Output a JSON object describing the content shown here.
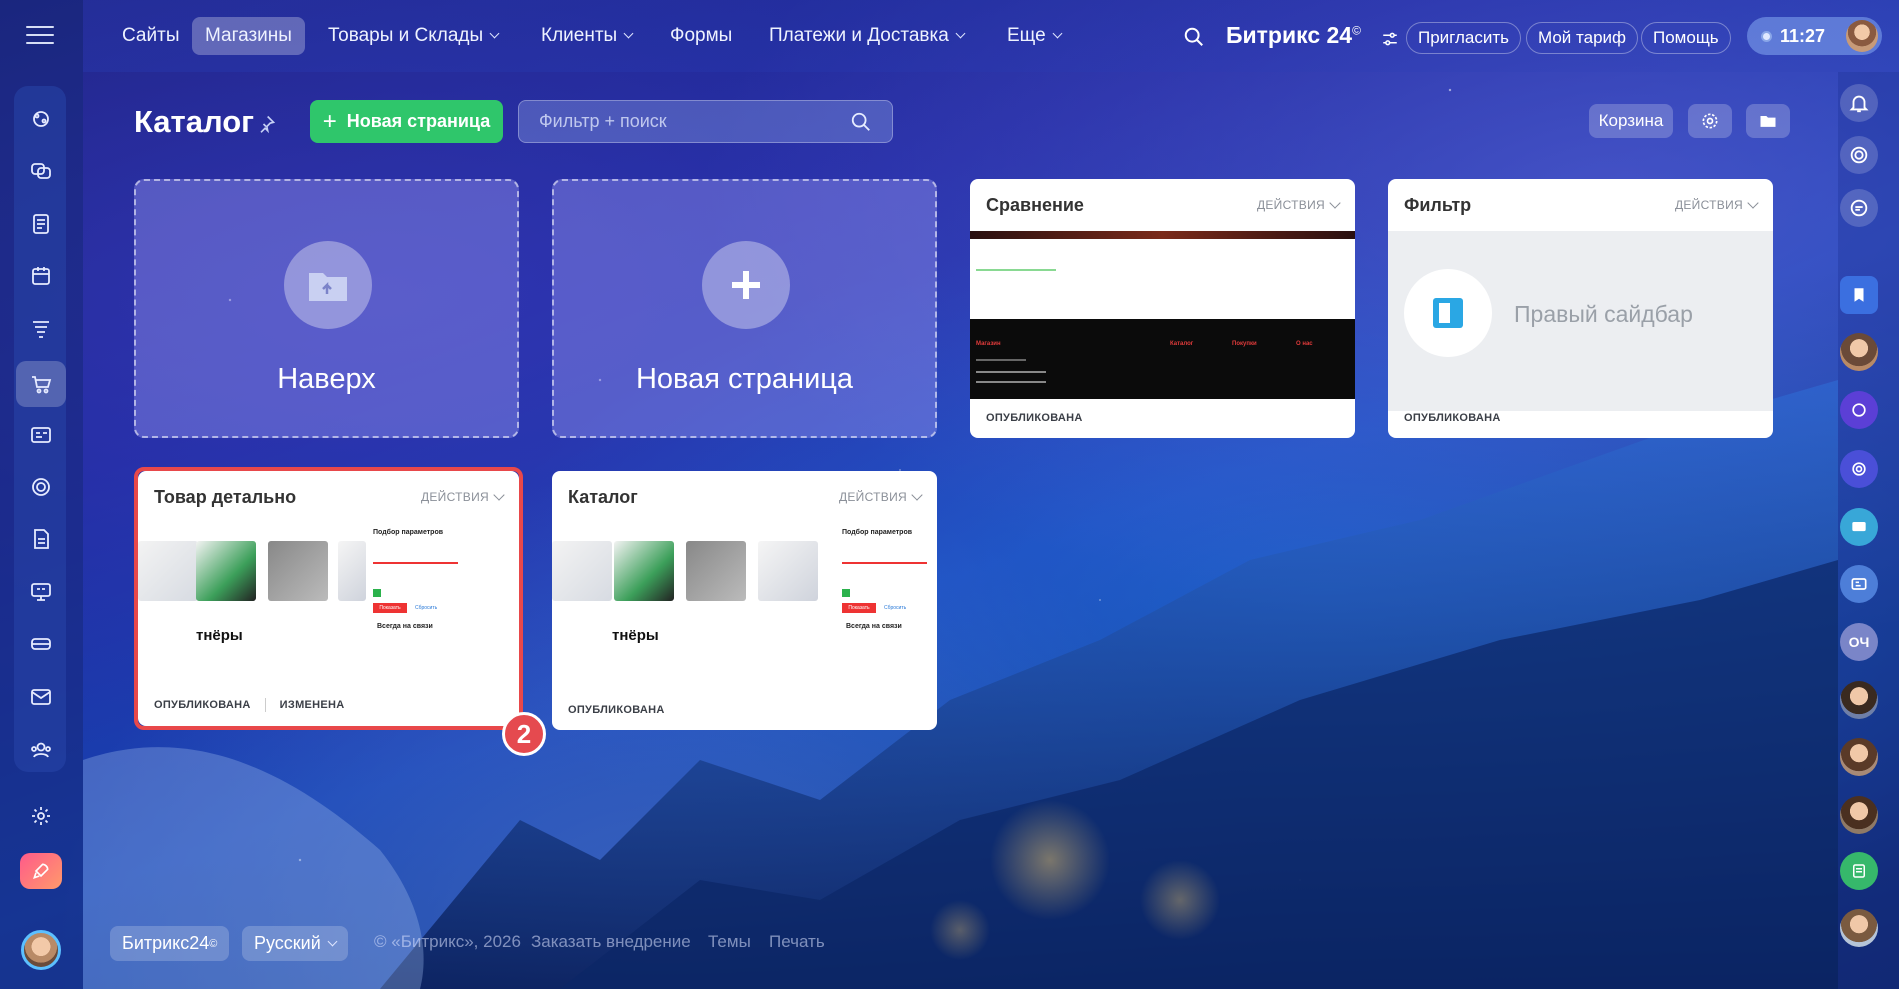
{
  "topnav": {
    "items": [
      {
        "label": "Сайты"
      },
      {
        "label": "Магазины",
        "active": true
      },
      {
        "label": "Товары и Склады",
        "dropdown": true
      },
      {
        "label": "Клиенты",
        "dropdown": true
      },
      {
        "label": "Формы"
      },
      {
        "label": "Платежи и Доставка",
        "dropdown": true
      },
      {
        "label": "Еще",
        "dropdown": true
      }
    ],
    "brand": "Битрикс 24",
    "brand_mark": "©",
    "invite_label": "Пригласить",
    "tariff_label": "Мой тариф",
    "help_label": "Помощь",
    "time": "11:27"
  },
  "page": {
    "title": "Каталог",
    "new_page_button": "Новая страница",
    "new_page_plus": "+",
    "search_placeholder": "Фильтр + поиск",
    "cart_button": "Корзина"
  },
  "cards": {
    "up": {
      "label": "Наверх"
    },
    "new_page": {
      "label": "Новая страница"
    },
    "comparison": {
      "title": "Сравнение",
      "actions": "ДЕЙСТВИЯ",
      "status": "ОПУБЛИКОВАНА",
      "preview": {
        "col1": "Магазин",
        "col2": "Каталог",
        "col3": "Покупки",
        "col4": "О нас"
      }
    },
    "filter": {
      "title": "Фильтр",
      "actions": "ДЕЙСТВИЯ",
      "status": "ОПУБЛИКОВАНА",
      "preview_text": "Правый сайдбар"
    },
    "product_detail": {
      "title": "Товар детально",
      "actions": "ДЕЙСТВИЯ",
      "status": "ОПУБЛИКОВАНА",
      "status2": "ИЗМЕНЕНА",
      "preview": {
        "filter_head": "Подбор параметров",
        "apply": "Показать",
        "reset": "Сбросить",
        "contact": "Всегда на связи",
        "brand": "тнёры"
      }
    },
    "catalog": {
      "title": "Каталог",
      "actions": "ДЕЙСТВИЯ",
      "status": "ОПУБЛИКОВАНА",
      "preview": {
        "filter_head": "Подбор параметров",
        "apply": "Показать",
        "reset": "Сбросить",
        "contact": "Всегда на связи",
        "brand": "тнёры"
      }
    }
  },
  "step_badge": "2",
  "right_rail": {
    "initials": "ОЧ"
  },
  "footer": {
    "brand": "Битрикс24",
    "brand_mark": "©",
    "language": "Русский",
    "copyright": "© «Битрикс», 2026",
    "order_link": "Заказать внедрение",
    "themes_link": "Темы",
    "print_link": "Печать"
  },
  "colors": {
    "accent_green": "#2fc66b",
    "highlight_red": "#e8484a",
    "badge_red": "#e54a4f"
  }
}
